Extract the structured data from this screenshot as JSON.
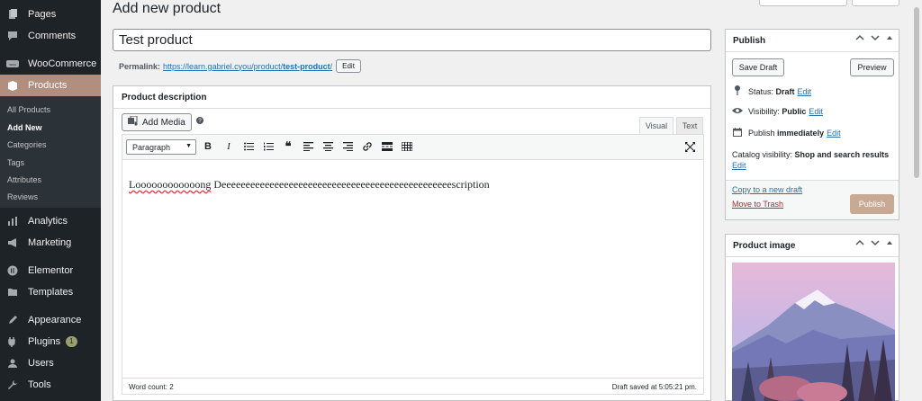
{
  "sidebar": {
    "items": [
      {
        "label": "Pages",
        "icon": "pages-icon"
      },
      {
        "label": "Comments",
        "icon": "comments-icon"
      },
      {
        "label": "WooCommerce",
        "icon": "woocommerce-icon"
      },
      {
        "label": "Products",
        "icon": "products-icon"
      },
      {
        "label": "Analytics",
        "icon": "analytics-icon"
      },
      {
        "label": "Marketing",
        "icon": "marketing-icon"
      },
      {
        "label": "Elementor",
        "icon": "elementor-icon"
      },
      {
        "label": "Templates",
        "icon": "templates-icon"
      },
      {
        "label": "Appearance",
        "icon": "appearance-icon"
      },
      {
        "label": "Plugins",
        "icon": "plugins-icon",
        "badge": "1"
      },
      {
        "label": "Users",
        "icon": "users-icon"
      },
      {
        "label": "Tools",
        "icon": "tools-icon"
      }
    ],
    "submenu": [
      "All Products",
      "Add New",
      "Categories",
      "Tags",
      "Attributes",
      "Reviews"
    ],
    "active_submenu": "Add New"
  },
  "page": {
    "title": "Add new product"
  },
  "product": {
    "title_value": "Test product",
    "permalink_label": "Permalink:",
    "permalink_base": "https://learn.gabriel.cyou/product/",
    "permalink_slug": "test-product",
    "permalink_trailing": "/",
    "permalink_edit": "Edit"
  },
  "description": {
    "heading": "Product description",
    "add_media": "Add Media",
    "tab_visual": "Visual",
    "tab_text": "Text",
    "format": "Paragraph",
    "content_word1": "Loooooooooooong",
    "content_word2": "Deeeeeeeeeeeeeeeeeeeeeeeeeeeeeeeeeeeeeeeeeeeeeeeescription",
    "word_count": "Word count: 2",
    "draft_saved": "Draft saved at 5:05:21 pm."
  },
  "publish": {
    "heading": "Publish",
    "save_draft": "Save Draft",
    "preview": "Preview",
    "status_label": "Status:",
    "status_value": "Draft",
    "visibility_label": "Visibility:",
    "visibility_value": "Public",
    "publish_label": "Publish",
    "publish_value": "immediately",
    "edit": "Edit",
    "catalog_label": "Catalog visibility:",
    "catalog_value": "Shop and search results",
    "copy_draft": "Copy to a new draft",
    "trash": "Move to Trash",
    "publish_button": "Publish"
  },
  "product_image": {
    "heading": "Product image"
  },
  "colors": {
    "sidebar_bg": "#1d2327",
    "accent_products": "#b18e7e",
    "link": "#2271b1",
    "trash": "#b32d2e",
    "publish_button": "#c8a994"
  }
}
